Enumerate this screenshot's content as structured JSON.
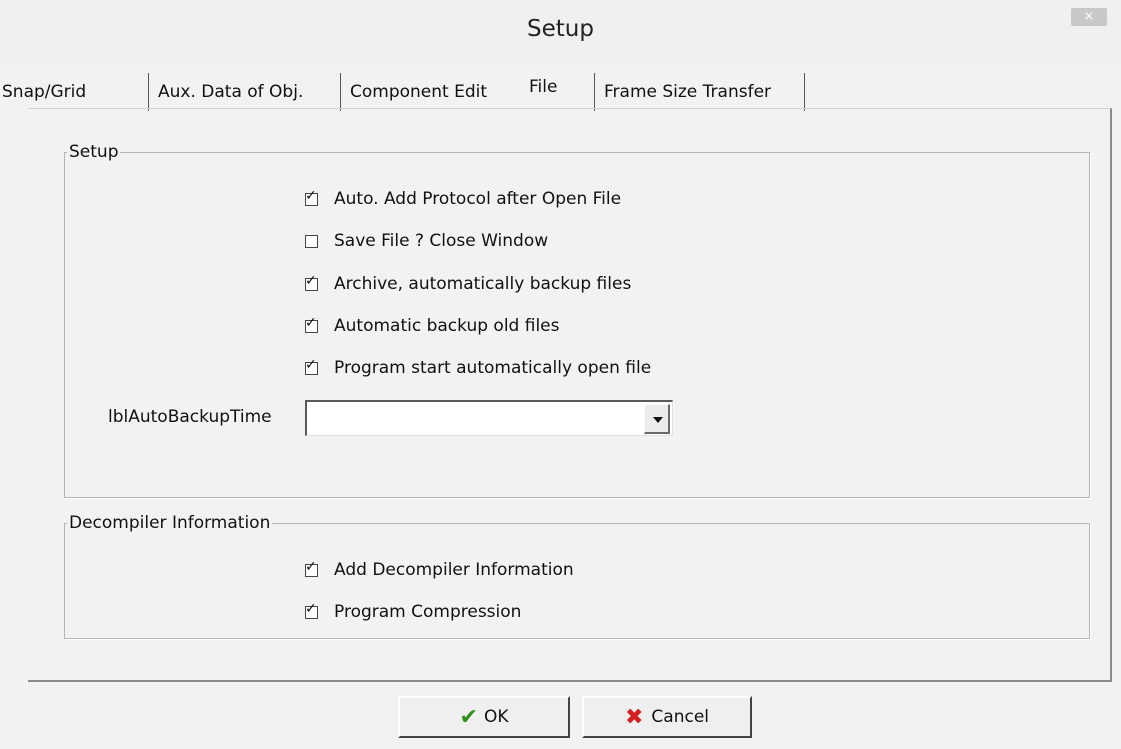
{
  "window": {
    "title": "Setup",
    "close_glyph": "×"
  },
  "tabs": [
    {
      "label": "Snap/Grid"
    },
    {
      "label": "Aux. Data of Obj."
    },
    {
      "label": "Component Edit"
    },
    {
      "label": "File",
      "active": true
    },
    {
      "label": "Frame Size Transfer"
    }
  ],
  "setup_group": {
    "legend": "Setup",
    "checkboxes": [
      {
        "label": "Auto. Add Protocol after Open File",
        "checked": true
      },
      {
        "label": "Save File ? Close Window",
        "checked": false
      },
      {
        "label": "Archive, automatically backup files",
        "checked": true
      },
      {
        "label": "Automatic backup old files",
        "checked": true
      },
      {
        "label": "Program start automatically open file",
        "checked": true
      }
    ],
    "backup_time_label": "lblAutoBackupTime",
    "backup_time_value": ""
  },
  "decompiler_group": {
    "legend": "Decompiler Information",
    "checkboxes": [
      {
        "label": "Add Decompiler Information",
        "checked": true
      },
      {
        "label": "Program Compression",
        "checked": true
      }
    ]
  },
  "buttons": {
    "ok_label": "OK",
    "ok_icon": "✔",
    "cancel_label": "Cancel",
    "cancel_icon": "✖"
  },
  "colors": {
    "ok_icon": "#2f8f1c",
    "cancel_icon": "#d42020"
  }
}
